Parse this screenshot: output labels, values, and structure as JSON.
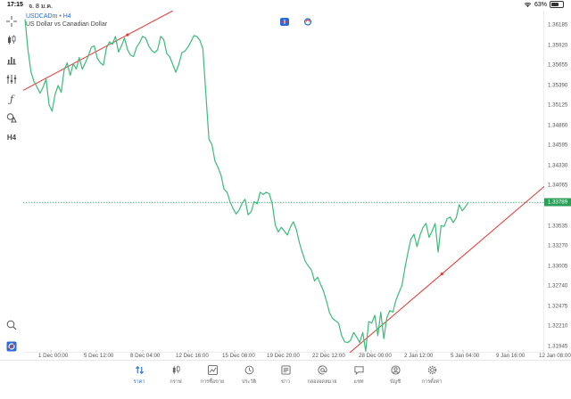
{
  "status_bar": {
    "time": "17:15",
    "date": "จ. 8 ม.ค.",
    "battery": "63%",
    "battery_level": 0.63
  },
  "symbol": {
    "name": "USDCADm",
    "separator": " • ",
    "timeframe": "H4",
    "description": "US Dollar vs Canadian Dollar"
  },
  "toolbar": {
    "items": [
      {
        "name": "crosshair-icon"
      },
      {
        "name": "candlestick-icon"
      },
      {
        "name": "bar-chart-icon"
      },
      {
        "name": "indicator-sliders-icon"
      },
      {
        "name": "function-icon"
      },
      {
        "name": "shapes-icon"
      },
      {
        "name": "timeframe-h4-label",
        "label": "H4"
      }
    ],
    "bottom_items": [
      {
        "name": "zoom-search-icon"
      },
      {
        "name": "app-logo-icon"
      }
    ]
  },
  "price_axis": {
    "labels": [
      "1.36185",
      "1.35920",
      "1.35655",
      "1.35390",
      "1.35125",
      "1.34860",
      "1.34595",
      "1.34330",
      "1.34065",
      "1.33535",
      "1.33270",
      "1.33005",
      "1.32740",
      "1.32475",
      "1.32210",
      "1.31945"
    ],
    "current_price": "1.33789"
  },
  "time_axis": {
    "labels": [
      "1 Dec 00:00",
      "5 Dec 12:00",
      "8 Dec 04:00",
      "12 Dec 16:00",
      "15 Dec 08:00",
      "19 Dec 20:00",
      "22 Dec 12:00",
      "28 Dec 00:00",
      "2 Jan 12:00",
      "5 Jan 04:00",
      "9 Jan 16:00",
      "12 Jan 08:00"
    ]
  },
  "colors": {
    "line": "#3cba7a",
    "trendline": "#e53935",
    "accent": "#2a6bd9",
    "current_price_bg": "#2e9e5b"
  },
  "chart_data": {
    "type": "line",
    "series": [
      {
        "y": [
          1.3614,
          1.3574,
          1.3546,
          1.3534,
          1.3527,
          1.3519,
          1.3527,
          1.3537,
          1.3504,
          1.3496,
          1.3518,
          1.3529,
          1.352,
          1.3549,
          1.3558,
          1.3542,
          1.3557,
          1.355,
          1.3565,
          1.355,
          1.3558,
          1.3567,
          1.3578,
          1.358,
          1.3564,
          1.3558,
          1.3555,
          1.3577,
          1.3585,
          1.3582,
          1.3592,
          1.3572,
          1.358,
          1.359,
          1.3575,
          1.3568,
          1.3566,
          1.3578,
          1.3584,
          1.3592,
          1.359,
          1.358,
          1.3574,
          1.3571,
          1.3575,
          1.3592,
          1.3588,
          1.357,
          1.3566,
          1.3556,
          1.3546,
          1.3556,
          1.3571,
          1.3573,
          1.3578,
          1.3585,
          1.3593,
          1.3592,
          1.3587,
          1.3576,
          1.3517,
          1.346,
          1.3453,
          1.3432,
          1.3424,
          1.3414,
          1.3396,
          1.3392,
          1.338,
          1.3371,
          1.3364,
          1.3369,
          1.3378,
          1.3383,
          1.3363,
          1.3367,
          1.338,
          1.3377,
          1.3392,
          1.3389,
          1.3392,
          1.339,
          1.3377,
          1.335,
          1.3341,
          1.3347,
          1.3342,
          1.3337,
          1.3347,
          1.3354,
          1.3344,
          1.3327,
          1.3314,
          1.3303,
          1.3297,
          1.3292,
          1.3278,
          1.3283,
          1.3274,
          1.3265,
          1.3252,
          1.3237,
          1.323,
          1.3227,
          1.3224,
          1.3208,
          1.32,
          1.3199,
          1.3202,
          1.3212,
          1.3206,
          1.3199,
          1.3212,
          1.3188,
          1.3226,
          1.3224,
          1.3234,
          1.3208,
          1.3238,
          1.3204,
          1.3231,
          1.324,
          1.3238,
          1.3253,
          1.3263,
          1.3272,
          1.3295,
          1.3315,
          1.3332,
          1.3338,
          1.3322,
          1.3337,
          1.3347,
          1.3352,
          1.3334,
          1.3342,
          1.3352,
          1.3315,
          1.3349,
          1.3348,
          1.3358,
          1.336,
          1.3353,
          1.3359,
          1.3376,
          1.3368,
          1.3373,
          1.3379
        ]
      }
    ],
    "trendlines": [
      {
        "x": [
          0,
          34
        ],
        "y": [
          1.3524,
          1.3594
        ]
      },
      {
        "x": [
          108,
          163
        ],
        "y": [
          1.3187,
          1.3369
        ]
      }
    ],
    "current_price": 1.33789,
    "ylim": [
      1.3186,
      1.3625
    ]
  }
}
